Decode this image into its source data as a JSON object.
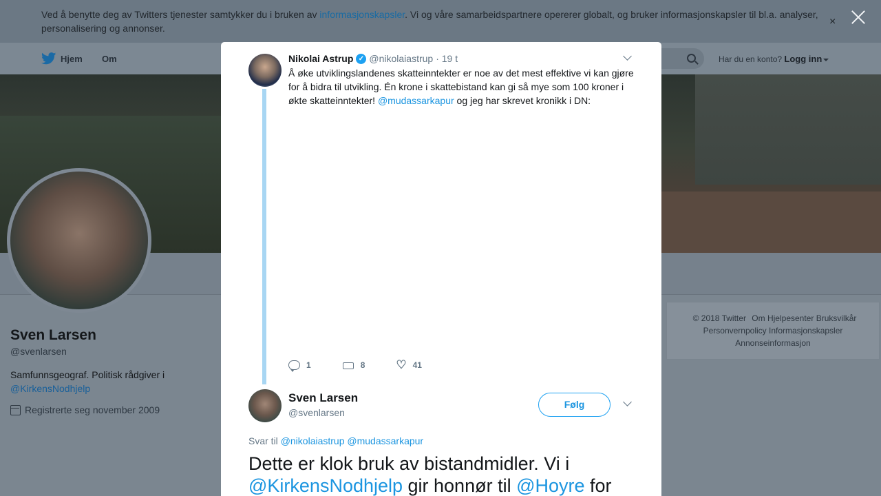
{
  "cookie_banner": {
    "text_before": "Ved å benytte deg av Twitters tjenester samtykker du i bruken av ",
    "link": "informasjonskapsler",
    "text_after": ". Vi og våre samarbeidspartnere opererer globalt, og bruker informasjonskapsler til bl.a. analyser, personalisering og annonser.",
    "close_glyph": "×"
  },
  "nav": {
    "home": "Hjem",
    "about": "Om",
    "account_prompt": "Har du en konto?",
    "login": "Logg inn"
  },
  "profile": {
    "name": "Sven Larsen",
    "handle": "@svenlarsen",
    "bio_text": "Samfunnsgeograf. Politisk rådgiver i",
    "bio_mention": "@KirkensNodhjelp",
    "joined": "Registrerte seg november 2009"
  },
  "footer": {
    "links_row1": [
      "© 2018 Twitter",
      "Om",
      "Hjelpesenter",
      "Bruksvilkår"
    ],
    "links_row2": [
      "Personvernpolicy",
      "Informasjonskapsler"
    ],
    "links_row3": [
      "Annonseinformasjon"
    ]
  },
  "tweet1": {
    "author_name": "Nikolai Astrup",
    "verified_glyph": "✓",
    "author_handle": "@nikolaiastrup",
    "time": "· 19 t",
    "text_before": "Å øke utviklingslandenes skatteinntekter er noe av det mest effektive vi kan gjøre for å bidra til utvikling. Én krone i skattebistand kan gi så mye som 100 kroner i økte skatteinntekter! ",
    "mention": "@mudassarkapur",
    "text_after": " og jeg har skrevet kronikk i DN:",
    "replies": "1",
    "retweets": "8",
    "likes": "41",
    "heart_glyph": "♡"
  },
  "tweet2": {
    "author_name": "Sven Larsen",
    "author_handle": "@svenlarsen",
    "follow_label": "Følg",
    "reply_prefix": "Svar til",
    "reply_mention1": "@nikolaiastrup",
    "reply_mention2": "@mudassarkapur",
    "text_part1": "Dette er klok bruk av bistandmidler. Vi i ",
    "mention1": "@KirkensNodhjelp",
    "text_part2": " gir honnør til ",
    "mention2": "@Hoyre",
    "text_part3": " for"
  }
}
